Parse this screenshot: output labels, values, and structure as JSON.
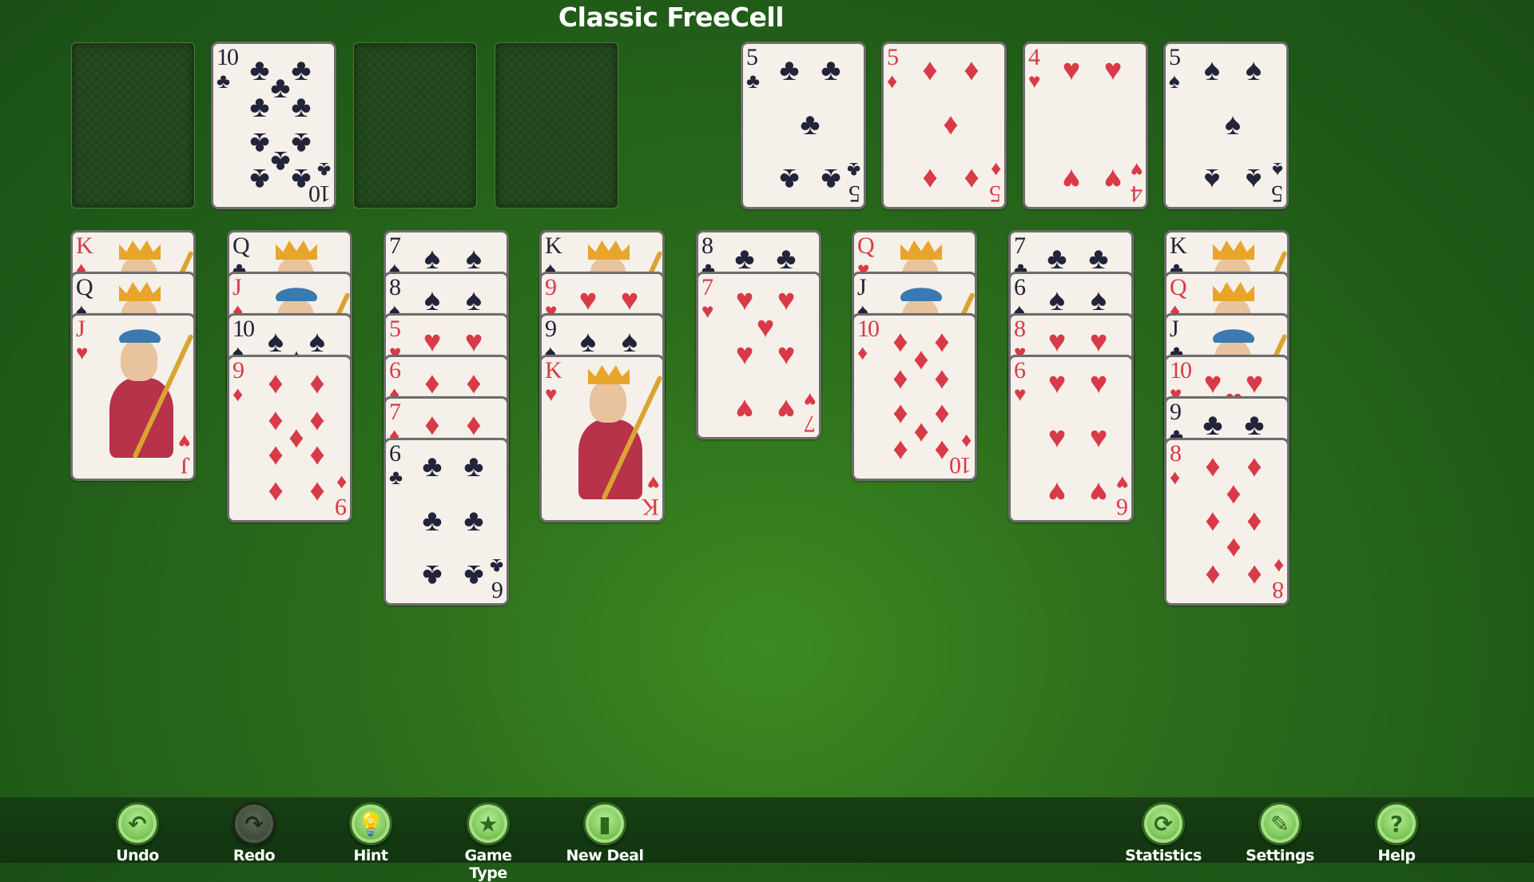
{
  "title": "Classic FreeCell",
  "colors": {
    "red": "#d93a48",
    "black": "#23233a",
    "felt": "#2c6e1c"
  },
  "free_cells": [
    null,
    {
      "rank": "10",
      "suit": "clubs"
    },
    null,
    null
  ],
  "foundations": [
    {
      "rank": "5",
      "suit": "clubs"
    },
    {
      "rank": "5",
      "suit": "diamonds"
    },
    {
      "rank": "4",
      "suit": "hearts"
    },
    {
      "rank": "5",
      "suit": "spades"
    }
  ],
  "tableau": [
    [
      {
        "rank": "K",
        "suit": "diamonds"
      },
      {
        "rank": "Q",
        "suit": "spades"
      },
      {
        "rank": "J",
        "suit": "hearts"
      }
    ],
    [
      {
        "rank": "Q",
        "suit": "clubs"
      },
      {
        "rank": "J",
        "suit": "diamonds"
      },
      {
        "rank": "10",
        "suit": "spades"
      },
      {
        "rank": "9",
        "suit": "diamonds"
      }
    ],
    [
      {
        "rank": "7",
        "suit": "spades"
      },
      {
        "rank": "8",
        "suit": "spades"
      },
      {
        "rank": "5",
        "suit": "hearts"
      },
      {
        "rank": "6",
        "suit": "diamonds"
      },
      {
        "rank": "7",
        "suit": "diamonds"
      },
      {
        "rank": "6",
        "suit": "clubs"
      }
    ],
    [
      {
        "rank": "K",
        "suit": "spades"
      },
      {
        "rank": "9",
        "suit": "hearts"
      },
      {
        "rank": "9",
        "suit": "spades"
      },
      {
        "rank": "K",
        "suit": "hearts"
      }
    ],
    [
      {
        "rank": "8",
        "suit": "clubs"
      },
      {
        "rank": "7",
        "suit": "hearts"
      }
    ],
    [
      {
        "rank": "Q",
        "suit": "hearts"
      },
      {
        "rank": "J",
        "suit": "spades"
      },
      {
        "rank": "10",
        "suit": "diamonds"
      }
    ],
    [
      {
        "rank": "7",
        "suit": "clubs"
      },
      {
        "rank": "6",
        "suit": "spades"
      },
      {
        "rank": "8",
        "suit": "hearts"
      },
      {
        "rank": "6",
        "suit": "hearts"
      }
    ],
    [
      {
        "rank": "K",
        "suit": "clubs"
      },
      {
        "rank": "Q",
        "suit": "diamonds"
      },
      {
        "rank": "J",
        "suit": "clubs"
      },
      {
        "rank": "10",
        "suit": "hearts"
      },
      {
        "rank": "9",
        "suit": "clubs"
      },
      {
        "rank": "8",
        "suit": "diamonds"
      }
    ]
  ],
  "toolbar": {
    "left": [
      {
        "id": "undo",
        "label": "Undo",
        "icon": "undo-icon",
        "glyph": "↶",
        "enabled": true
      },
      {
        "id": "redo",
        "label": "Redo",
        "icon": "redo-icon",
        "glyph": "↷",
        "enabled": false
      },
      {
        "id": "hint",
        "label": "Hint",
        "icon": "lightbulb-icon",
        "glyph": "💡",
        "enabled": true
      },
      {
        "id": "game-type",
        "label": "Game Type",
        "icon": "star-icon",
        "glyph": "★",
        "enabled": true
      },
      {
        "id": "new-deal",
        "label": "New Deal",
        "icon": "cards-icon",
        "glyph": "▮",
        "enabled": true
      }
    ],
    "right": [
      {
        "id": "statistics",
        "label": "Statistics",
        "icon": "refresh-icon",
        "glyph": "⟳",
        "enabled": true
      },
      {
        "id": "settings",
        "label": "Settings",
        "icon": "pencil-icon",
        "glyph": "✎",
        "enabled": true
      },
      {
        "id": "help",
        "label": "Help",
        "icon": "question-icon",
        "glyph": "?",
        "enabled": true
      }
    ]
  }
}
